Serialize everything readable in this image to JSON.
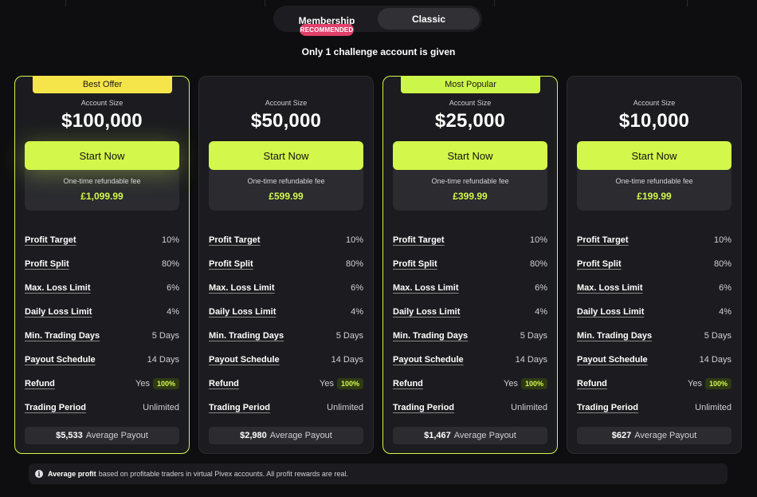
{
  "toggle": {
    "membership_label": "Membership",
    "classic_label": "Classic",
    "recommended_badge": "RECOMMENDED"
  },
  "subtitle": "Only 1 challenge account is given",
  "row_labels": {
    "profit_target": "Profit Target",
    "profit_split": "Profit Split",
    "max_loss_limit": "Max. Loss Limit",
    "daily_loss_limit": "Daily Loss Limit",
    "min_trading_days": "Min. Trading Days",
    "payout_schedule": "Payout Schedule",
    "refund": "Refund",
    "trading_period": "Trading Period"
  },
  "common": {
    "account_size_label": "Account Size",
    "start_label": "Start Now",
    "fee_label": "One-time refundable fee",
    "average_payout_label": "Average Payout",
    "profit_target": "10%",
    "profit_split": "80%",
    "max_loss_limit": "6%",
    "daily_loss_limit": "4%",
    "min_trading_days": "5 Days",
    "payout_schedule": "14 Days",
    "refund_value": "Yes",
    "refund_badge": "100%",
    "trading_period": "Unlimited"
  },
  "cards": [
    {
      "tag": "Best Offer",
      "size": "$100,000",
      "fee": "£1,099.99",
      "avg_payout": "$5,533"
    },
    {
      "tag": "",
      "size": "$50,000",
      "fee": "£599.99",
      "avg_payout": "$2,980"
    },
    {
      "tag": "Most Popular",
      "size": "$25,000",
      "fee": "£399.99",
      "avg_payout": "$1,467"
    },
    {
      "tag": "",
      "size": "$10,000",
      "fee": "£199.99",
      "avg_payout": "$627"
    }
  ],
  "footer": {
    "bold": "Average profit",
    "text": "based on profitable traders in virtual Pivex accounts. All profit rewards are real."
  },
  "colors": {
    "accent": "#d3f74a",
    "best_offer_tag": "#f6e54a",
    "recommended": "#e0406a",
    "background": "#0e0e10",
    "card": "#1c1c20"
  },
  "icons": {
    "footer": "info-icon"
  }
}
